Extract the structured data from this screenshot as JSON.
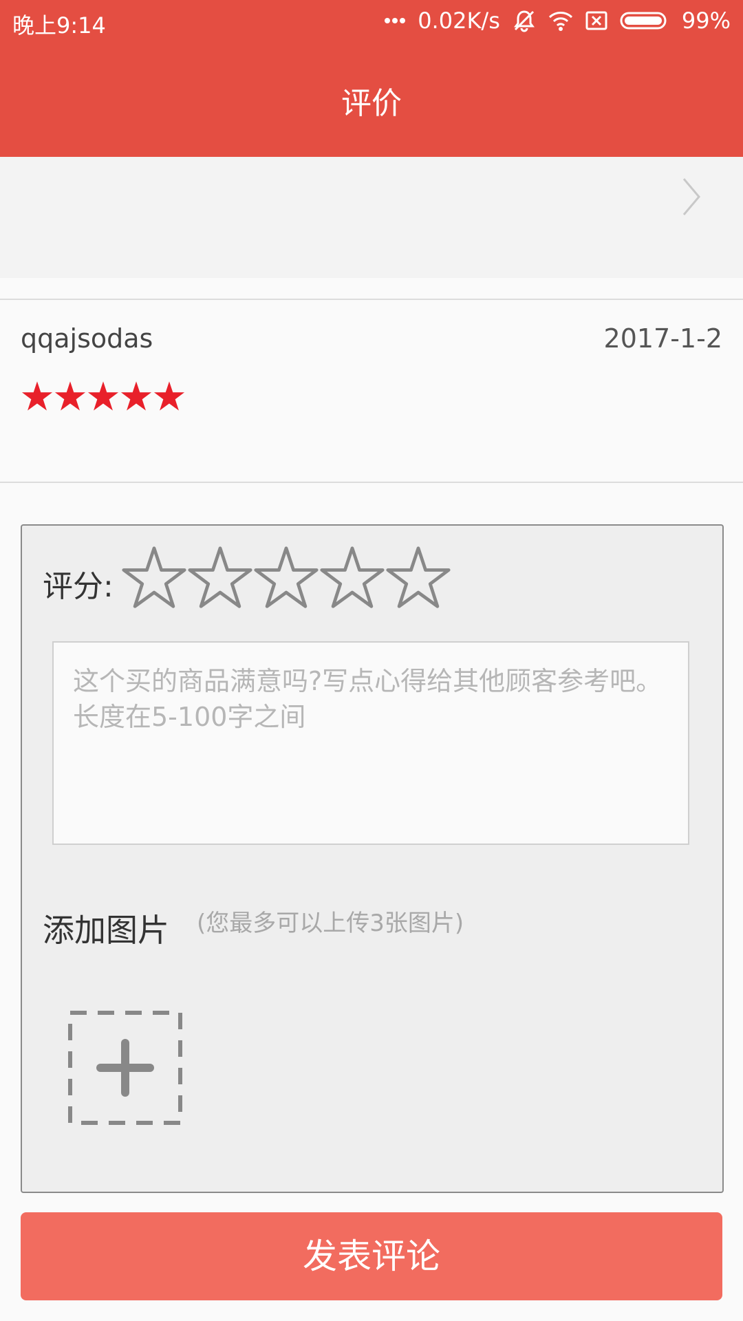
{
  "status_bar": {
    "time": "晚上9:14",
    "network_speed": "0.02K/s",
    "battery": "99%",
    "icons": [
      "more-dots-icon",
      "mute-bell-icon",
      "wifi-icon",
      "no-sim-icon",
      "battery-icon"
    ]
  },
  "app_bar": {
    "title": "评价"
  },
  "review": {
    "username": "qqajsodas",
    "date": "2017-1-2",
    "rating_stars": 5,
    "star_color": "#e8202a"
  },
  "form": {
    "rating_label": "评分:",
    "rating_value": 0,
    "rating_max": 5,
    "comment_placeholder": "这个买的商品满意吗?写点心得给其他顾客参考吧。长度在5-100字之间",
    "add_photo_label": "添加图片",
    "add_photo_hint": "(您最多可以上传3张图片)"
  },
  "submit_label": "发表评论",
  "colors": {
    "primary": "#e44e42",
    "button": "#f26c5f"
  }
}
